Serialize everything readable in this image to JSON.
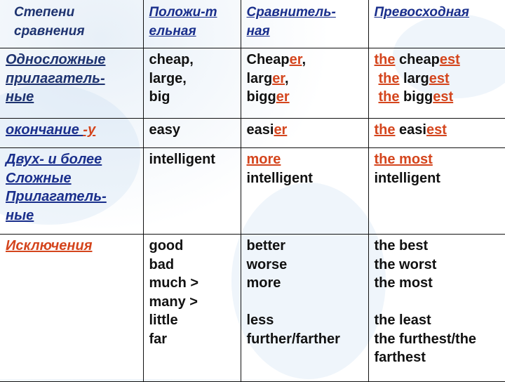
{
  "header": {
    "col1": [
      "Степени",
      "сравнения"
    ],
    "col2": [
      "Положи-т",
      "ельная"
    ],
    "col3": [
      "Сравнитель-",
      "ная"
    ],
    "col4": [
      "Превосходная"
    ]
  },
  "rows": [
    {
      "category": [
        "Односложные",
        "прилагатель-",
        "ные"
      ],
      "positive": [
        "cheap,",
        "large,",
        "big"
      ],
      "comparative": [
        {
          "base": "Cheap",
          "suffix": "er",
          "tail": ","
        },
        {
          "base": "larg",
          "suffix": "er",
          "tail": ","
        },
        {
          "base": "bigg",
          "suffix": "er",
          "tail": ""
        }
      ],
      "superlative": [
        {
          "article": "the",
          "base": " cheap",
          "suffix": "est"
        },
        {
          "article": "the",
          "base": " larg",
          "suffix": "est"
        },
        {
          "article": "the",
          "base": " bigg",
          "suffix": "est"
        }
      ]
    },
    {
      "category_text": "окончание ",
      "category_suffix": "-y",
      "positive": "easy",
      "comparative": {
        "base": "easi",
        "suffix": "er"
      },
      "superlative": {
        "article": "the",
        "base": " easi",
        "suffix": "est"
      }
    },
    {
      "category": [
        "Двух- и более",
        "Сложные",
        "Прилагатель-",
        "ные"
      ],
      "positive": "intelligent",
      "comparative": {
        "modifier": "more",
        "word": "intelligent"
      },
      "superlative": {
        "modifier": "the most",
        "word": "intelligent"
      }
    },
    {
      "category": "Исключения",
      "positive": [
        "good",
        "bad",
        "much >",
        "many >",
        "little",
        "far"
      ],
      "comparative": [
        "better",
        "worse",
        "more",
        "",
        "less",
        "further/farther"
      ],
      "superlative": [
        "the best",
        "the worst",
        "the most",
        "",
        "the least",
        "the furthest/the",
        "farthest"
      ]
    }
  ],
  "colors": {
    "header_blue": "#1a2f8c",
    "accent_red": "#d4451d",
    "text": "#111111"
  }
}
